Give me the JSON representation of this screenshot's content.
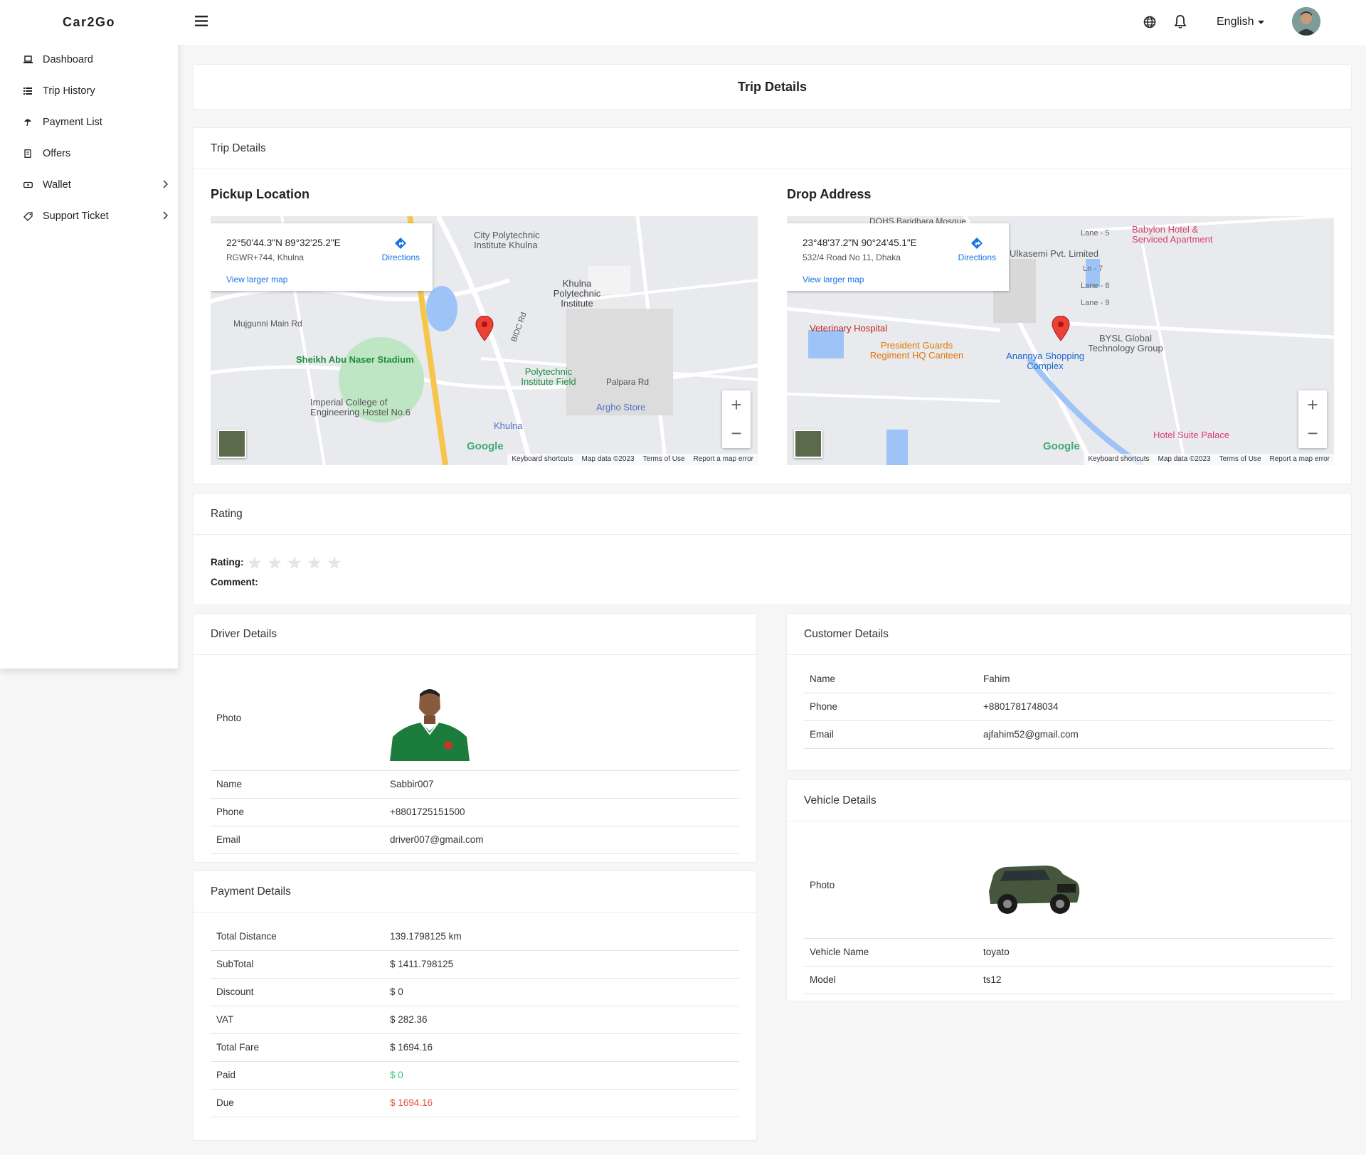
{
  "brand": "Car2Go",
  "sidebar": {
    "items": [
      {
        "label": "Dashboard",
        "icon": "laptop-icon"
      },
      {
        "label": "Trip History",
        "icon": "list-icon"
      },
      {
        "label": "Payment List",
        "icon": "umbrella-icon"
      },
      {
        "label": "Offers",
        "icon": "receipt-icon"
      },
      {
        "label": "Wallet",
        "icon": "wallet-icon",
        "chevron": true
      },
      {
        "label": "Support Ticket",
        "icon": "tag-icon",
        "chevron": true
      }
    ]
  },
  "topbar": {
    "language": "English"
  },
  "page_title": "Trip Details",
  "trip": {
    "section_title": "Trip Details",
    "pickup": {
      "title": "Pickup Location",
      "coords": "22°50'44.3\"N 89°32'25.2\"E",
      "address": "RGWR+744, Khulna",
      "directions": "Directions",
      "larger": "View larger map",
      "labels": [
        "City Polytechnic Institute Khulna",
        "Khulna Polytechnic Institute",
        "Mujgunni Main Rd",
        "Sheikh Abu Naser Stadium",
        "Imperial College of Engineering Hostel No.6",
        "Polytechnic Institute Field",
        "Palpara Rd",
        "Argho Store",
        "Khulna",
        "BIDC Rd"
      ],
      "attribution": [
        "Keyboard shortcuts",
        "Map data ©2023",
        "Terms of Use",
        "Report a map error"
      ]
    },
    "drop": {
      "title": "Drop Address",
      "coords": "23°48'37.2\"N 90°24'45.1\"E",
      "address": "532/4 Road No 11, Dhaka",
      "directions": "Directions",
      "larger": "View larger map",
      "labels": [
        "DOHS Baridhara Mosque",
        "Babylon Hotel & Serviced Apartment",
        "Ulkasemi Pvt. Limited",
        "Veterinary Hospital",
        "President Guards Regiment HQ Canteen",
        "Anannya Shopping Complex",
        "BYSL Global Technology Group",
        "Hotel Suite Palace",
        "Lane - 5",
        "Lane - 8",
        "Lane - 9",
        "Ln - 7"
      ],
      "attribution": [
        "Keyboard shortcuts",
        "Map data ©2023",
        "Terms of Use",
        "Report a map error"
      ]
    }
  },
  "rating": {
    "title": "Rating",
    "rating_label": "Rating:",
    "comment_label": "Comment:",
    "stars": 5,
    "value": 0
  },
  "driver": {
    "title": "Driver Details",
    "photo_label": "Photo",
    "rows": [
      {
        "k": "Name",
        "v": "Sabbir007"
      },
      {
        "k": "Phone",
        "v": "+8801725151500"
      },
      {
        "k": "Email",
        "v": "driver007@gmail.com"
      }
    ]
  },
  "customer": {
    "title": "Customer Details",
    "rows": [
      {
        "k": "Name",
        "v": "Fahim"
      },
      {
        "k": "Phone",
        "v": "+8801781748034"
      },
      {
        "k": "Email",
        "v": "ajfahim52@gmail.com"
      }
    ]
  },
  "vehicle": {
    "title": "Vehicle Details",
    "photo_label": "Photo",
    "rows": [
      {
        "k": "Vehicle Name",
        "v": "toyato"
      },
      {
        "k": "Model",
        "v": "ts12"
      }
    ]
  },
  "payment": {
    "title": "Payment Details",
    "rows": [
      {
        "k": "Total Distance",
        "v": "139.1798125 km"
      },
      {
        "k": "SubTotal",
        "v": "$ 1411.798125"
      },
      {
        "k": "Discount",
        "v": "$ 0"
      },
      {
        "k": "VAT",
        "v": "$ 282.36"
      },
      {
        "k": "Total Fare",
        "v": "$ 1694.16"
      },
      {
        "k": "Paid",
        "v": "$ 0"
      },
      {
        "k": "Due",
        "v": "$ 1694.16"
      }
    ]
  },
  "colors": {
    "paid": "#2ecc71",
    "due": "#e74c3c",
    "link": "#1a73e8",
    "pin": "#ea4335"
  }
}
